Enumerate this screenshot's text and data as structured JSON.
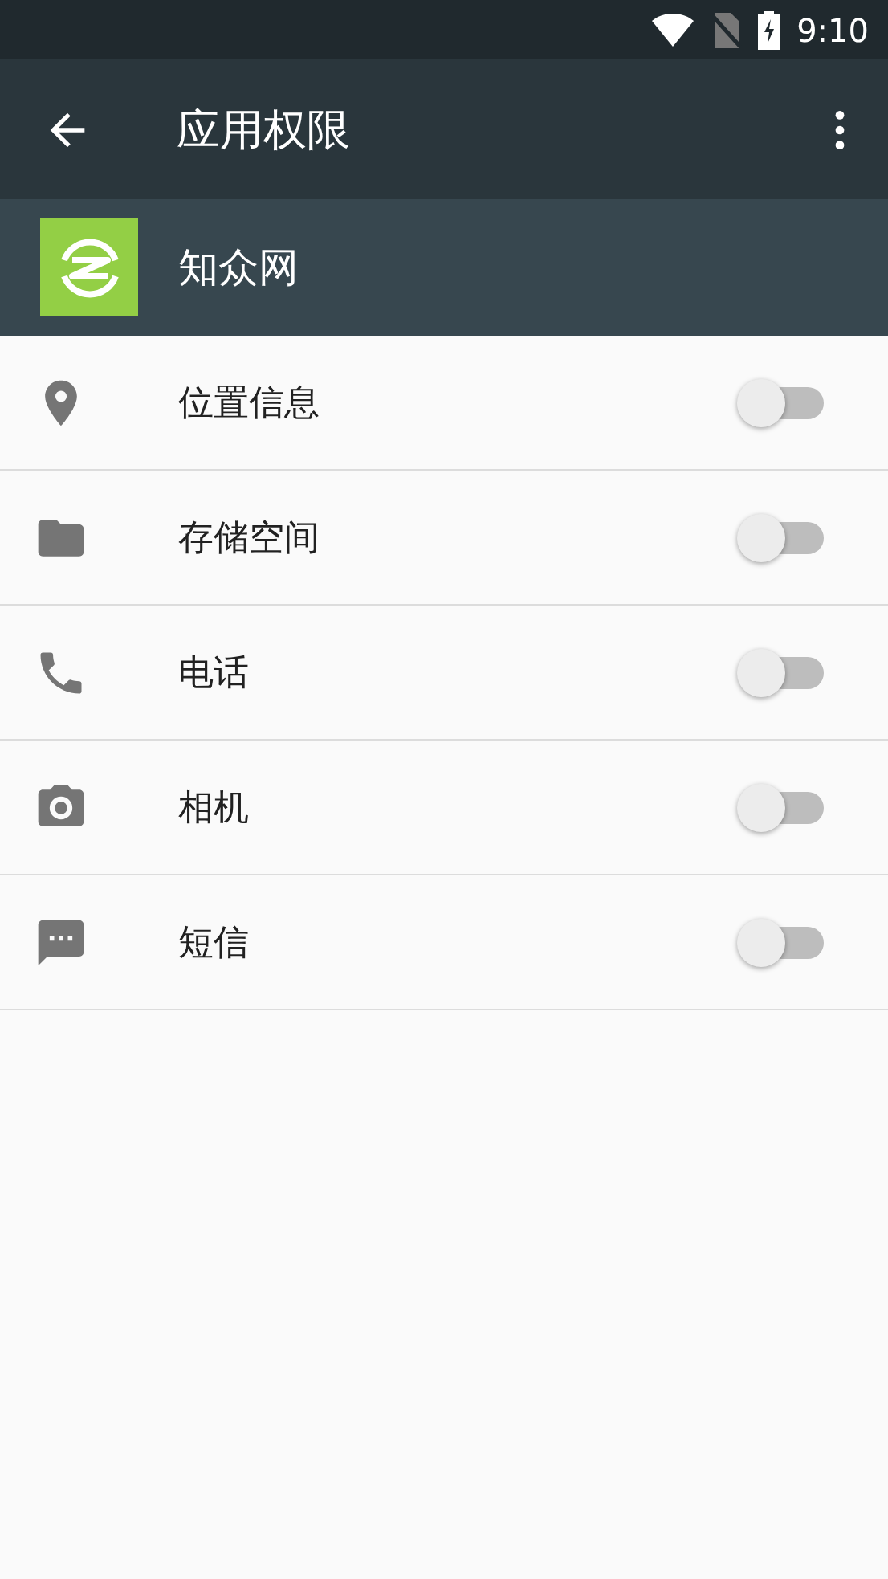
{
  "status_bar": {
    "time": "9:10"
  },
  "toolbar": {
    "title": "应用权限"
  },
  "app": {
    "name": "知众网"
  },
  "permissions": [
    {
      "kind": "location",
      "label": "位置信息",
      "on": false
    },
    {
      "kind": "storage",
      "label": "存储空间",
      "on": false
    },
    {
      "kind": "phone",
      "label": "电话",
      "on": false
    },
    {
      "kind": "camera",
      "label": "相机",
      "on": false
    },
    {
      "kind": "sms",
      "label": "短信",
      "on": false
    }
  ]
}
